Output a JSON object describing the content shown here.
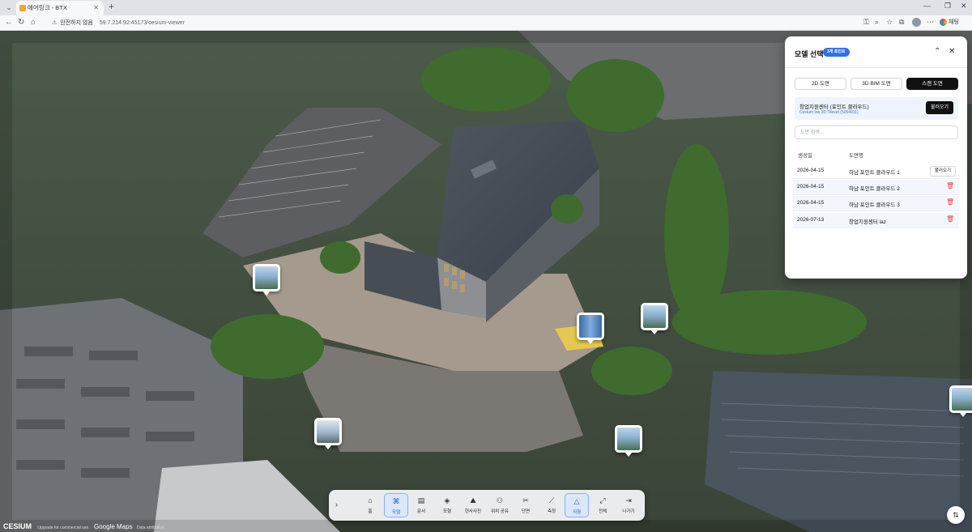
{
  "browser": {
    "tab_title": "에어링크 - BTX",
    "new_tab": "+",
    "security_label": "안전하지 않음",
    "url": "59.7.214.92:45173/cesium-viewer",
    "chat_label": "채팅"
  },
  "panel": {
    "title": "모델 선택",
    "badge": "3개 포인트",
    "tabs": [
      {
        "label": "2D 도면",
        "active": false
      },
      {
        "label": "3D BIM 도면",
        "active": false
      },
      {
        "label": "스캔 도면",
        "active": true
      }
    ],
    "current_model": {
      "name": "창업지원센터 (포인트 클라우드)",
      "subtitle": "Cesium Ion 3D Tileset (5054911)",
      "load_label": "불러오기"
    },
    "search_placeholder": "도면 검색...",
    "columns": {
      "date": "생성일",
      "name": "도면명"
    },
    "rows": [
      {
        "date": "2026-04-15",
        "name": "하남 포인트 클라우드 1",
        "action": "불러오기"
      },
      {
        "date": "2026-04-15",
        "name": "하남 포인트 클라우드 2",
        "action": "delete"
      },
      {
        "date": "2026-04-15",
        "name": "하남 포인트 클라우드 3",
        "action": "delete"
      },
      {
        "date": "2026-07-13",
        "name": "창업지원센터 laz",
        "action": "delete"
      }
    ]
  },
  "toolbar": {
    "items": [
      {
        "icon": "home-icon",
        "label": "홈",
        "active": false
      },
      {
        "icon": "model-icon",
        "label": "모델",
        "active": true
      },
      {
        "icon": "document-icon",
        "label": "문서",
        "active": false
      },
      {
        "icon": "layers-icon",
        "label": "모형",
        "active": false
      },
      {
        "icon": "panorama-icon",
        "label": "현사사진",
        "active": false
      },
      {
        "icon": "people-icon",
        "label": "위치 공유",
        "active": false
      },
      {
        "icon": "scissors-icon",
        "label": "단면",
        "active": false
      },
      {
        "icon": "ruler-icon",
        "label": "측정",
        "active": false
      },
      {
        "icon": "terrain-icon",
        "label": "지형",
        "active": true
      },
      {
        "icon": "fullscreen-icon",
        "label": "전체",
        "active": false
      },
      {
        "icon": "exit-icon",
        "label": "나가기",
        "active": false
      }
    ]
  },
  "credits": {
    "logo": "CESIUM",
    "upgrade": "Upgrade for commercial use.",
    "google": "Google Maps",
    "data": "Data attribution"
  },
  "colors": {
    "accent": "#2f6fed",
    "danger": "#e5484d",
    "active_bg": "#dbe7fb"
  }
}
